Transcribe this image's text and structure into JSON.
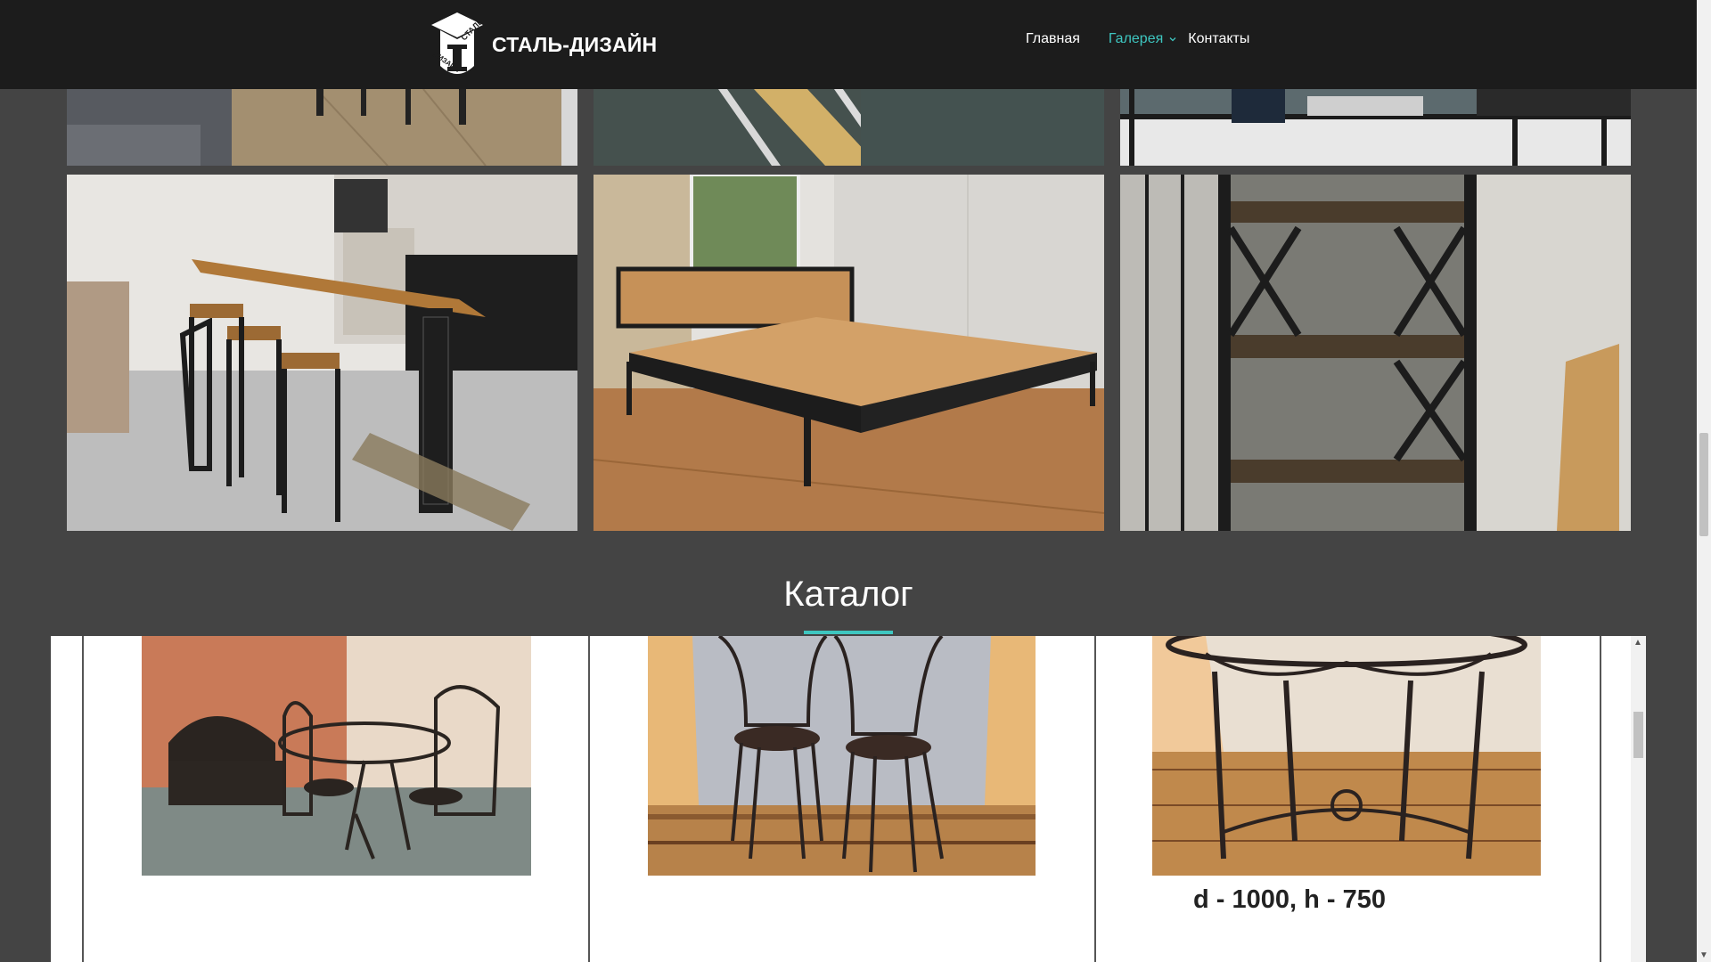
{
  "header": {
    "logo_text": "СТАЛЬ-ДИЗАЙН",
    "logo_badge": [
      "СТАЛЬ",
      "ДИЗАЙН"
    ],
    "nav": [
      {
        "label": "Главная",
        "active": false
      },
      {
        "label": "Галерея",
        "active": true,
        "has_dropdown": true
      },
      {
        "label": "Контакты",
        "active": false
      }
    ]
  },
  "catalog": {
    "title": "Каталог",
    "items": [
      {
        "image": "wrought-iron-dining-set"
      },
      {
        "image": "wrought-iron-chairs"
      },
      {
        "image": "wrought-iron-round-table",
        "caption": "d - 1000, h - 750"
      }
    ]
  },
  "colors": {
    "header_bg": "#1c1c1c",
    "page_bg": "#444444",
    "accent": "#3ec6c0"
  }
}
